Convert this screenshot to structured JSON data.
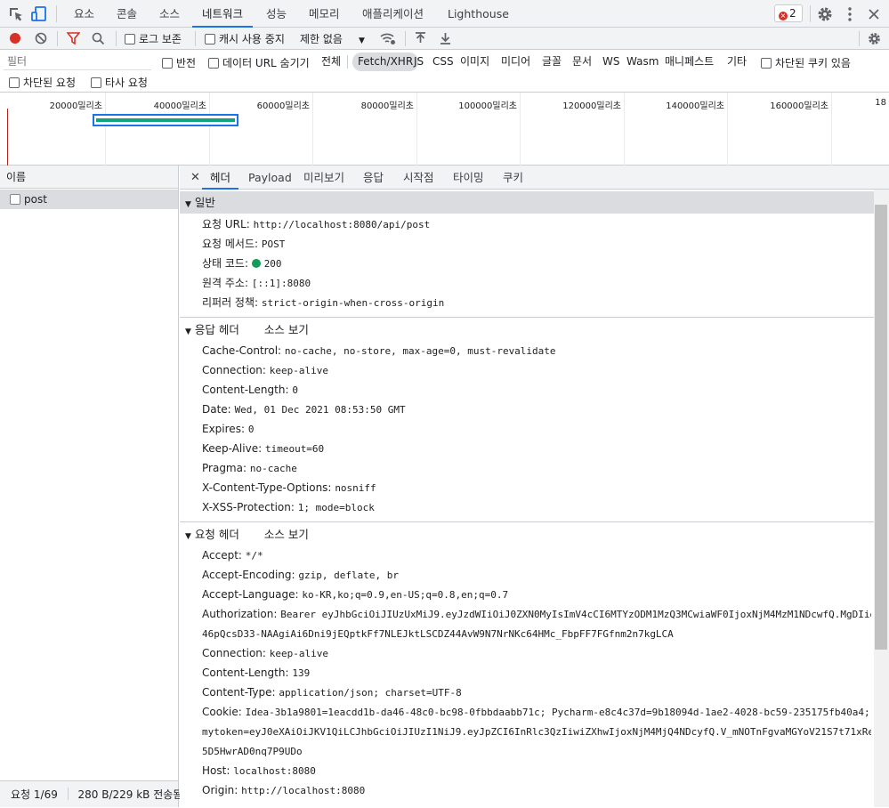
{
  "top_tabs": [
    "요소",
    "콘솔",
    "소스",
    "네트워크",
    "성능",
    "메모리",
    "애플리케이션",
    "Lighthouse"
  ],
  "error_count": "2",
  "toolbar": {
    "preserve_log": "로그 보존",
    "disable_cache": "캐시 사용 중지",
    "throttle": "제한 없음"
  },
  "filter": {
    "placeholder": "필터",
    "invert": "반전",
    "hide_data_urls": "데이터 URL 숨기기",
    "types": [
      "전체",
      "Fetch/XHR",
      "JS",
      "CSS",
      "이미지",
      "미디어",
      "글꼴",
      "문서",
      "WS",
      "Wasm",
      "매니페스트",
      "기타"
    ],
    "blocked_cookies": "차단된 쿠키 있음",
    "blocked_requests": "차단된 요청",
    "third_party": "타사 요청"
  },
  "timeline_ticks": [
    "20000밀리초",
    "40000밀리초",
    "60000밀리초",
    "80000밀리초",
    "100000밀리초",
    "120000밀리초",
    "140000밀리초",
    "160000밀리초",
    "18"
  ],
  "request_list": {
    "header": "이름",
    "items": [
      "post"
    ],
    "status_count": "요청 1/69",
    "status_size": "280 B/229 kB 전송됨"
  },
  "detail_tabs": [
    "헤더",
    "Payload",
    "미리보기",
    "응답",
    "시작점",
    "타이밍",
    "쿠키"
  ],
  "general": {
    "title": "일반",
    "rows": [
      {
        "k": "요청 URL:",
        "v": "http://localhost:8080/api/post"
      },
      {
        "k": "요청 메서드:",
        "v": "POST"
      },
      {
        "k": "상태 코드:",
        "v": "200"
      },
      {
        "k": "원격 주소:",
        "v": "[::1]:8080"
      },
      {
        "k": "리퍼러 정책:",
        "v": "strict-origin-when-cross-origin"
      }
    ]
  },
  "response_headers": {
    "title": "응답 헤더",
    "view_source": "소스 보기",
    "rows": [
      {
        "k": "Cache-Control:",
        "v": "no-cache, no-store, max-age=0, must-revalidate"
      },
      {
        "k": "Connection:",
        "v": "keep-alive"
      },
      {
        "k": "Content-Length:",
        "v": "0"
      },
      {
        "k": "Date:",
        "v": "Wed, 01 Dec 2021 08:53:50 GMT"
      },
      {
        "k": "Expires:",
        "v": "0"
      },
      {
        "k": "Keep-Alive:",
        "v": "timeout=60"
      },
      {
        "k": "Pragma:",
        "v": "no-cache"
      },
      {
        "k": "X-Content-Type-Options:",
        "v": "nosniff"
      },
      {
        "k": "X-XSS-Protection:",
        "v": "1; mode=block"
      }
    ]
  },
  "request_headers": {
    "title": "요청 헤더",
    "view_source": "소스 보기",
    "rows": [
      {
        "k": "Accept:",
        "v": "*/*"
      },
      {
        "k": "Accept-Encoding:",
        "v": "gzip, deflate, br"
      },
      {
        "k": "Accept-Language:",
        "v": "ko-KR,ko;q=0.9,en-US;q=0.8,en;q=0.7"
      },
      {
        "k": "Authorization:",
        "v": "Bearer eyJhbGciOiJIUzUxMiJ9.eyJzdWIiOiJ0ZXN0MyIsImV4cCI6MTYzODM1MzQ3MCwiaWF0IjoxNjM4MzM1NDcwfQ.MgDIie",
        "v2": "46pQcsD33-NAAgiAi6Dni9jEQptkFf7NLEJktLSCDZ44AvW9N7NrNKc64HMc_FbpFF7FGfnm2n7kgLCA"
      },
      {
        "k": "Connection:",
        "v": "keep-alive"
      },
      {
        "k": "Content-Length:",
        "v": "139"
      },
      {
        "k": "Content-Type:",
        "v": "application/json; charset=UTF-8"
      },
      {
        "k": "Cookie:",
        "v": "Idea-3b1a9801=1eacdd1b-da46-48c0-bc98-0fbbdaabb71c; Pycharm-e8c4c37d=9b18094d-1ae2-4028-bc59-235175fb40a4;",
        "v2": "mytoken=eyJ0eXAiOiJKV1QiLCJhbGciOiJIUzI1NiJ9.eyJpZCI6InRlc3QzIiwiZXhwIjoxNjM4MjQ4NDcyfQ.V_mNOTnFgvaMGYoV21S7t71xRe",
        "v3": "5D5HwrAD0nq7P9UDo"
      },
      {
        "k": "Host:",
        "v": "localhost:8080"
      },
      {
        "k": "Origin:",
        "v": "http://localhost:8080"
      }
    ]
  }
}
